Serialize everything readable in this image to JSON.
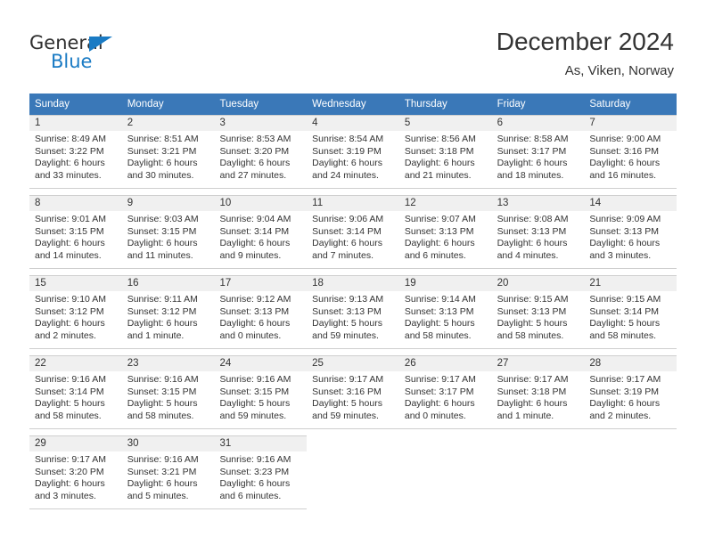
{
  "brand": {
    "name_part1": "General",
    "name_part2": "Blue",
    "accent_color": "#1a7bc4"
  },
  "header": {
    "title": "December 2024",
    "subtitle": "As, Viken, Norway"
  },
  "theme": {
    "header_row_bg": "#3a78b8",
    "day_number_bg": "#f0f0f0",
    "cell_border": "#cfcfcf",
    "text_color": "#333333"
  },
  "weekdays": [
    "Sunday",
    "Monday",
    "Tuesday",
    "Wednesday",
    "Thursday",
    "Friday",
    "Saturday"
  ],
  "weeks": [
    [
      {
        "day": "1",
        "sunrise": "Sunrise: 8:49 AM",
        "sunset": "Sunset: 3:22 PM",
        "daylight1": "Daylight: 6 hours",
        "daylight2": "and 33 minutes."
      },
      {
        "day": "2",
        "sunrise": "Sunrise: 8:51 AM",
        "sunset": "Sunset: 3:21 PM",
        "daylight1": "Daylight: 6 hours",
        "daylight2": "and 30 minutes."
      },
      {
        "day": "3",
        "sunrise": "Sunrise: 8:53 AM",
        "sunset": "Sunset: 3:20 PM",
        "daylight1": "Daylight: 6 hours",
        "daylight2": "and 27 minutes."
      },
      {
        "day": "4",
        "sunrise": "Sunrise: 8:54 AM",
        "sunset": "Sunset: 3:19 PM",
        "daylight1": "Daylight: 6 hours",
        "daylight2": "and 24 minutes."
      },
      {
        "day": "5",
        "sunrise": "Sunrise: 8:56 AM",
        "sunset": "Sunset: 3:18 PM",
        "daylight1": "Daylight: 6 hours",
        "daylight2": "and 21 minutes."
      },
      {
        "day": "6",
        "sunrise": "Sunrise: 8:58 AM",
        "sunset": "Sunset: 3:17 PM",
        "daylight1": "Daylight: 6 hours",
        "daylight2": "and 18 minutes."
      },
      {
        "day": "7",
        "sunrise": "Sunrise: 9:00 AM",
        "sunset": "Sunset: 3:16 PM",
        "daylight1": "Daylight: 6 hours",
        "daylight2": "and 16 minutes."
      }
    ],
    [
      {
        "day": "8",
        "sunrise": "Sunrise: 9:01 AM",
        "sunset": "Sunset: 3:15 PM",
        "daylight1": "Daylight: 6 hours",
        "daylight2": "and 14 minutes."
      },
      {
        "day": "9",
        "sunrise": "Sunrise: 9:03 AM",
        "sunset": "Sunset: 3:15 PM",
        "daylight1": "Daylight: 6 hours",
        "daylight2": "and 11 minutes."
      },
      {
        "day": "10",
        "sunrise": "Sunrise: 9:04 AM",
        "sunset": "Sunset: 3:14 PM",
        "daylight1": "Daylight: 6 hours",
        "daylight2": "and 9 minutes."
      },
      {
        "day": "11",
        "sunrise": "Sunrise: 9:06 AM",
        "sunset": "Sunset: 3:14 PM",
        "daylight1": "Daylight: 6 hours",
        "daylight2": "and 7 minutes."
      },
      {
        "day": "12",
        "sunrise": "Sunrise: 9:07 AM",
        "sunset": "Sunset: 3:13 PM",
        "daylight1": "Daylight: 6 hours",
        "daylight2": "and 6 minutes."
      },
      {
        "day": "13",
        "sunrise": "Sunrise: 9:08 AM",
        "sunset": "Sunset: 3:13 PM",
        "daylight1": "Daylight: 6 hours",
        "daylight2": "and 4 minutes."
      },
      {
        "day": "14",
        "sunrise": "Sunrise: 9:09 AM",
        "sunset": "Sunset: 3:13 PM",
        "daylight1": "Daylight: 6 hours",
        "daylight2": "and 3 minutes."
      }
    ],
    [
      {
        "day": "15",
        "sunrise": "Sunrise: 9:10 AM",
        "sunset": "Sunset: 3:12 PM",
        "daylight1": "Daylight: 6 hours",
        "daylight2": "and 2 minutes."
      },
      {
        "day": "16",
        "sunrise": "Sunrise: 9:11 AM",
        "sunset": "Sunset: 3:12 PM",
        "daylight1": "Daylight: 6 hours",
        "daylight2": "and 1 minute."
      },
      {
        "day": "17",
        "sunrise": "Sunrise: 9:12 AM",
        "sunset": "Sunset: 3:13 PM",
        "daylight1": "Daylight: 6 hours",
        "daylight2": "and 0 minutes."
      },
      {
        "day": "18",
        "sunrise": "Sunrise: 9:13 AM",
        "sunset": "Sunset: 3:13 PM",
        "daylight1": "Daylight: 5 hours",
        "daylight2": "and 59 minutes."
      },
      {
        "day": "19",
        "sunrise": "Sunrise: 9:14 AM",
        "sunset": "Sunset: 3:13 PM",
        "daylight1": "Daylight: 5 hours",
        "daylight2": "and 58 minutes."
      },
      {
        "day": "20",
        "sunrise": "Sunrise: 9:15 AM",
        "sunset": "Sunset: 3:13 PM",
        "daylight1": "Daylight: 5 hours",
        "daylight2": "and 58 minutes."
      },
      {
        "day": "21",
        "sunrise": "Sunrise: 9:15 AM",
        "sunset": "Sunset: 3:14 PM",
        "daylight1": "Daylight: 5 hours",
        "daylight2": "and 58 minutes."
      }
    ],
    [
      {
        "day": "22",
        "sunrise": "Sunrise: 9:16 AM",
        "sunset": "Sunset: 3:14 PM",
        "daylight1": "Daylight: 5 hours",
        "daylight2": "and 58 minutes."
      },
      {
        "day": "23",
        "sunrise": "Sunrise: 9:16 AM",
        "sunset": "Sunset: 3:15 PM",
        "daylight1": "Daylight: 5 hours",
        "daylight2": "and 58 minutes."
      },
      {
        "day": "24",
        "sunrise": "Sunrise: 9:16 AM",
        "sunset": "Sunset: 3:15 PM",
        "daylight1": "Daylight: 5 hours",
        "daylight2": "and 59 minutes."
      },
      {
        "day": "25",
        "sunrise": "Sunrise: 9:17 AM",
        "sunset": "Sunset: 3:16 PM",
        "daylight1": "Daylight: 5 hours",
        "daylight2": "and 59 minutes."
      },
      {
        "day": "26",
        "sunrise": "Sunrise: 9:17 AM",
        "sunset": "Sunset: 3:17 PM",
        "daylight1": "Daylight: 6 hours",
        "daylight2": "and 0 minutes."
      },
      {
        "day": "27",
        "sunrise": "Sunrise: 9:17 AM",
        "sunset": "Sunset: 3:18 PM",
        "daylight1": "Daylight: 6 hours",
        "daylight2": "and 1 minute."
      },
      {
        "day": "28",
        "sunrise": "Sunrise: 9:17 AM",
        "sunset": "Sunset: 3:19 PM",
        "daylight1": "Daylight: 6 hours",
        "daylight2": "and 2 minutes."
      }
    ],
    [
      {
        "day": "29",
        "sunrise": "Sunrise: 9:17 AM",
        "sunset": "Sunset: 3:20 PM",
        "daylight1": "Daylight: 6 hours",
        "daylight2": "and 3 minutes."
      },
      {
        "day": "30",
        "sunrise": "Sunrise: 9:16 AM",
        "sunset": "Sunset: 3:21 PM",
        "daylight1": "Daylight: 6 hours",
        "daylight2": "and 5 minutes."
      },
      {
        "day": "31",
        "sunrise": "Sunrise: 9:16 AM",
        "sunset": "Sunset: 3:23 PM",
        "daylight1": "Daylight: 6 hours",
        "daylight2": "and 6 minutes."
      },
      null,
      null,
      null,
      null
    ]
  ]
}
